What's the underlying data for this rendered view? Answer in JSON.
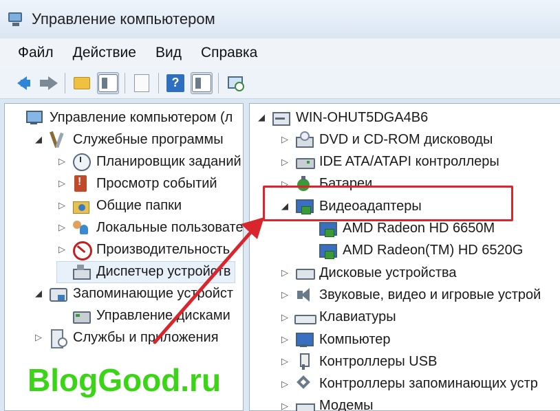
{
  "window": {
    "title": "Управление компьютером"
  },
  "menu": [
    "Файл",
    "Действие",
    "Вид",
    "Справка"
  ],
  "left_tree": [
    {
      "label": "Управление компьютером (л",
      "icon": "computer-icon",
      "expander": "",
      "indent": 0
    },
    {
      "label": "Служебные программы",
      "icon": "tools-icon",
      "expander": "open",
      "indent": 1
    },
    {
      "label": "Планировщик заданий",
      "icon": "clock-icon",
      "expander": "closed",
      "indent": 2
    },
    {
      "label": "Просмотр событий",
      "icon": "event-viewer-icon",
      "expander": "closed",
      "indent": 2
    },
    {
      "label": "Общие папки",
      "icon": "shared-folder-icon",
      "expander": "closed",
      "indent": 2
    },
    {
      "label": "Локальные пользовате",
      "icon": "users-icon",
      "expander": "closed",
      "indent": 2
    },
    {
      "label": "Производительность",
      "icon": "performance-icon",
      "expander": "closed",
      "indent": 2
    },
    {
      "label": "Диспетчер устройств",
      "icon": "device-manager-icon",
      "expander": "",
      "indent": 2,
      "selected": true
    },
    {
      "label": "Запоминающие устройст",
      "icon": "storage-icon",
      "expander": "open",
      "indent": 1
    },
    {
      "label": "Управление дисками",
      "icon": "disk-icon",
      "expander": "",
      "indent": 2
    },
    {
      "label": "Службы и приложения",
      "icon": "services-icon",
      "expander": "closed",
      "indent": 1
    }
  ],
  "right_tree": [
    {
      "label": "WIN-OHUT5DGA4B6",
      "icon": "host-icon",
      "expander": "open",
      "indent": 0
    },
    {
      "label": "DVD и CD-ROM дисководы",
      "icon": "dvd-drive-icon",
      "expander": "closed",
      "indent": 1
    },
    {
      "label": "IDE ATA/ATAPI контроллеры",
      "icon": "ide-controller-icon",
      "expander": "closed",
      "indent": 1
    },
    {
      "label": "Батареи",
      "icon": "battery-icon",
      "expander": "closed",
      "indent": 1
    },
    {
      "label": "Видеоадаптеры",
      "icon": "video-adapter-icon",
      "expander": "open",
      "indent": 1
    },
    {
      "label": "AMD Radeon HD 6650M",
      "icon": "video-adapter-icon",
      "expander": "",
      "indent": 2
    },
    {
      "label": "AMD Radeon(TM) HD 6520G",
      "icon": "video-adapter-icon",
      "expander": "",
      "indent": 2
    },
    {
      "label": "Дисковые устройства",
      "icon": "disk-device-icon",
      "expander": "closed",
      "indent": 1
    },
    {
      "label": "Звуковые, видео и игровые устрой",
      "icon": "sound-icon",
      "expander": "closed",
      "indent": 1
    },
    {
      "label": "Клавиатуры",
      "icon": "keyboard-icon",
      "expander": "closed",
      "indent": 1
    },
    {
      "label": "Компьютер",
      "icon": "pc-icon",
      "expander": "closed",
      "indent": 1
    },
    {
      "label": "Контроллеры USB",
      "icon": "usb-icon",
      "expander": "closed",
      "indent": 1
    },
    {
      "label": "Контроллеры запоминающих устр",
      "icon": "storage-controller-icon",
      "expander": "closed",
      "indent": 1
    },
    {
      "label": "Модемы",
      "icon": "modem-icon",
      "expander": "closed",
      "indent": 1
    }
  ],
  "watermark": "BlogGood.ru",
  "colors": {
    "highlight": "#d9262c",
    "watermark": "#3cd416",
    "arrow": "#d9262c"
  }
}
